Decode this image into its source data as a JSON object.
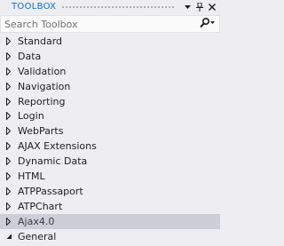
{
  "toolbox": {
    "title": "TOOLBOX",
    "search_placeholder": "Search Toolbox",
    "categories": [
      {
        "label": "Standard",
        "expanded": false
      },
      {
        "label": "Data",
        "expanded": false
      },
      {
        "label": "Validation",
        "expanded": false
      },
      {
        "label": "Navigation",
        "expanded": false
      },
      {
        "label": "Reporting",
        "expanded": false
      },
      {
        "label": "Login",
        "expanded": false
      },
      {
        "label": "WebParts",
        "expanded": false
      },
      {
        "label": "AJAX Extensions",
        "expanded": false
      },
      {
        "label": "Dynamic Data",
        "expanded": false
      },
      {
        "label": "HTML",
        "expanded": false
      },
      {
        "label": "ATPPassaport",
        "expanded": false
      },
      {
        "label": "ATPChart",
        "expanded": false
      },
      {
        "label": "Ajax4.0",
        "expanded": false,
        "selected": true
      },
      {
        "label": "General",
        "expanded": true
      }
    ]
  },
  "colors": {
    "title": "#0e70c0",
    "background": "#eeeef2",
    "selected_row": "#ccced8"
  }
}
